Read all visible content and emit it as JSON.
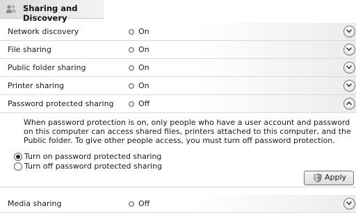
{
  "header": {
    "title": "Sharing and Discovery",
    "icon": "network-users-icon"
  },
  "rows": [
    {
      "label": "Network discovery",
      "status": "On",
      "expanded": false
    },
    {
      "label": "File sharing",
      "status": "On",
      "expanded": false
    },
    {
      "label": "Public folder sharing",
      "status": "On",
      "expanded": false
    },
    {
      "label": "Printer sharing",
      "status": "On",
      "expanded": false
    },
    {
      "label": "Password protected sharing",
      "status": "Off",
      "expanded": true
    }
  ],
  "details": {
    "description": "When password protection is on, only people who have a user account and password on this computer can access shared files, printers attached to this computer, and the Public folder. To give other people access, you must turn off password protection.",
    "options": [
      {
        "label": "Turn on password protected sharing",
        "checked": true
      },
      {
        "label": "Turn off password protected sharing",
        "checked": false
      }
    ],
    "apply_label": "Apply"
  },
  "media_row": {
    "label": "Media sharing",
    "status": "Off",
    "expanded": false
  }
}
